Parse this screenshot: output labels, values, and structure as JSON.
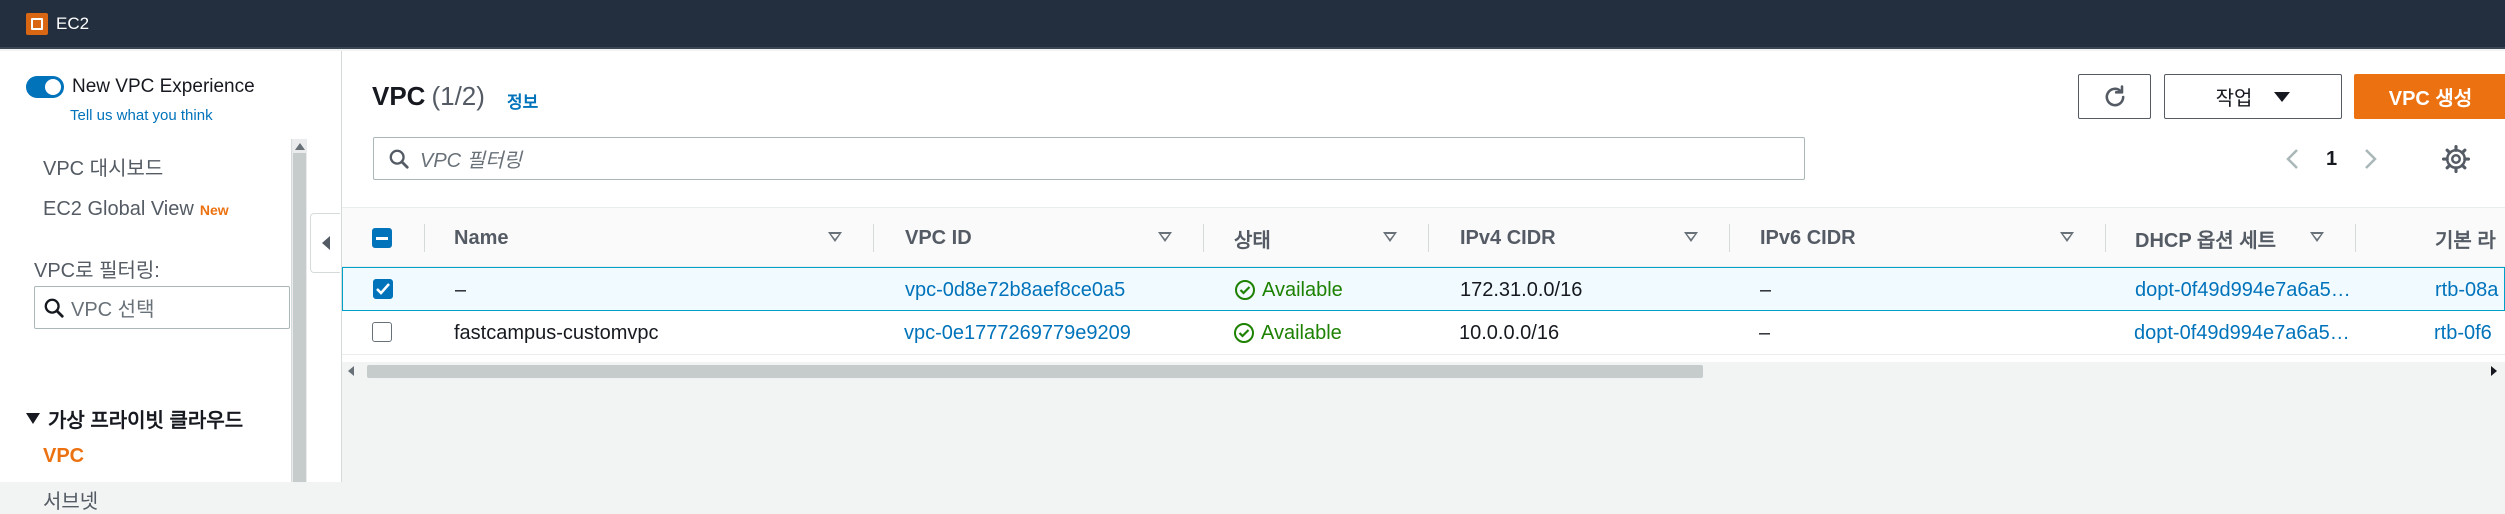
{
  "topbar": {
    "service": "EC2",
    "logo_icon": "ec2-service-icon"
  },
  "sidebar": {
    "toggle_label": "New VPC Experience",
    "feedback_link": "Tell us what you think",
    "dashboard": "VPC 대시보드",
    "global_view": "EC2 Global View",
    "new_badge": "New",
    "filter_label": "VPC로 필터링:",
    "vpc_select_placeholder": "VPC 선택",
    "section": "가상 프라이빗 클라우드",
    "items": [
      {
        "label": "VPC",
        "active": true
      },
      {
        "label": "서브넷",
        "active": false
      }
    ]
  },
  "panel": {
    "title": "VPC",
    "count": "(1/2)",
    "info": "정보",
    "actions_label": "작업",
    "create_label": "VPC 생성",
    "filter_placeholder": "VPC 필터링",
    "page": "1"
  },
  "table": {
    "columns": [
      "Name",
      "VPC ID",
      "상태",
      "IPv4 CIDR",
      "IPv6 CIDR",
      "DHCP 옵션 세트",
      "기본 라"
    ],
    "rows": [
      {
        "selected": true,
        "name": "–",
        "vpc_id": "vpc-0d8e72b8aef8ce0a5",
        "status": "Available",
        "ipv4": "172.31.0.0/16",
        "ipv6": "–",
        "dhcp": "dopt-0f49d994e7a6a5…",
        "route": "rtb-08a"
      },
      {
        "selected": false,
        "name": "fastcampus-customvpc",
        "vpc_id": "vpc-0e1777269779e9209",
        "status": "Available",
        "ipv4": "10.0.0.0/16",
        "ipv6": "–",
        "dhcp": "dopt-0f49d994e7a6a5…",
        "route": "rtb-0f6"
      }
    ]
  },
  "colors": {
    "accent": "#ec7211",
    "link": "#0073bb",
    "success": "#1d8102",
    "topbar": "#232f3e"
  }
}
